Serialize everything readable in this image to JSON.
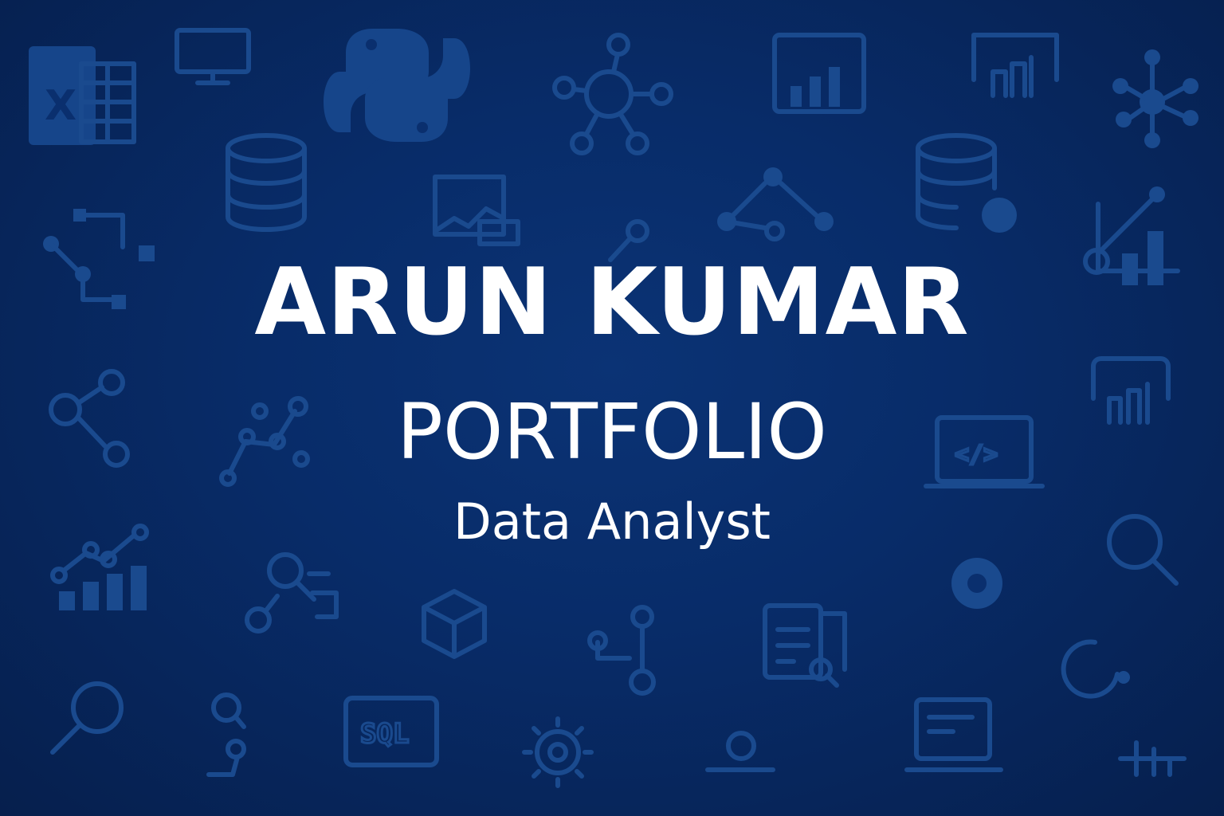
{
  "hero": {
    "name": "ARUN KUMAR",
    "subtitle": "PORTFOLIO",
    "role": "Data Analyst"
  },
  "background_icons": {
    "excel_letter": "X",
    "sql_label": "SQL",
    "code_label": "</>"
  },
  "colors": {
    "background": "#082c69",
    "background_edge": "#061f4d",
    "icon": "#1a4a8e",
    "text": "#ffffff"
  }
}
